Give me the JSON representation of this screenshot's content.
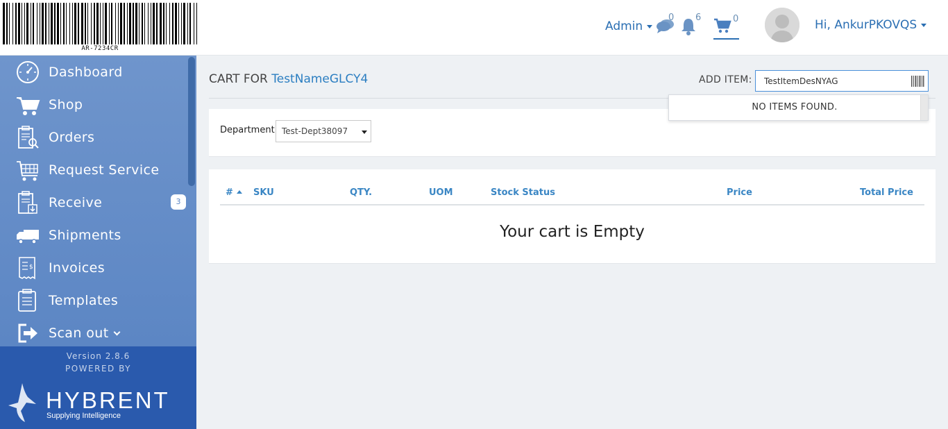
{
  "header": {
    "logo_code": "AR-7234CR",
    "admin_label": "Admin",
    "messages_count": "0",
    "notifications_count": "6",
    "cart_count": "0",
    "greeting": "Hi, AnkurPKOVQS"
  },
  "sidebar": {
    "items": [
      {
        "label": "Dashboard",
        "icon": "dashboard-icon"
      },
      {
        "label": "Shop",
        "icon": "cart-icon"
      },
      {
        "label": "Orders",
        "icon": "orders-icon"
      },
      {
        "label": "Request Service",
        "icon": "request-service-icon"
      },
      {
        "label": "Receive",
        "icon": "receive-icon",
        "badge": "3"
      },
      {
        "label": "Shipments",
        "icon": "truck-icon"
      },
      {
        "label": "Invoices",
        "icon": "invoice-icon"
      },
      {
        "label": "Templates",
        "icon": "templates-icon"
      },
      {
        "label": "Scan out",
        "icon": "scan-out-icon"
      }
    ],
    "version": "Version 2.8.6",
    "powered_by": "POWERED BY",
    "brand_name": "HYBRENT",
    "brand_tagline": "Supplying Intelligence"
  },
  "main": {
    "title_prefix": "CART FOR",
    "customer": "TestNameGLCY4",
    "add_item_label": "ADD ITEM:",
    "add_item_value": "TestItemDesNYAG",
    "dropdown_message": "NO ITEMS FOUND.",
    "department_label": "Department",
    "department_value": "Test-Dept38097",
    "columns": [
      "#",
      "SKU",
      "QTY.",
      "UOM",
      "Stock Status",
      "Price",
      "Total Price"
    ],
    "empty_message": "Your cart is Empty"
  },
  "colors": {
    "accent": "#2b6fb3",
    "sidebar_bg": "#6f95cc",
    "sidebar_footer": "#2a5aad",
    "table_header": "#3a86c4"
  }
}
